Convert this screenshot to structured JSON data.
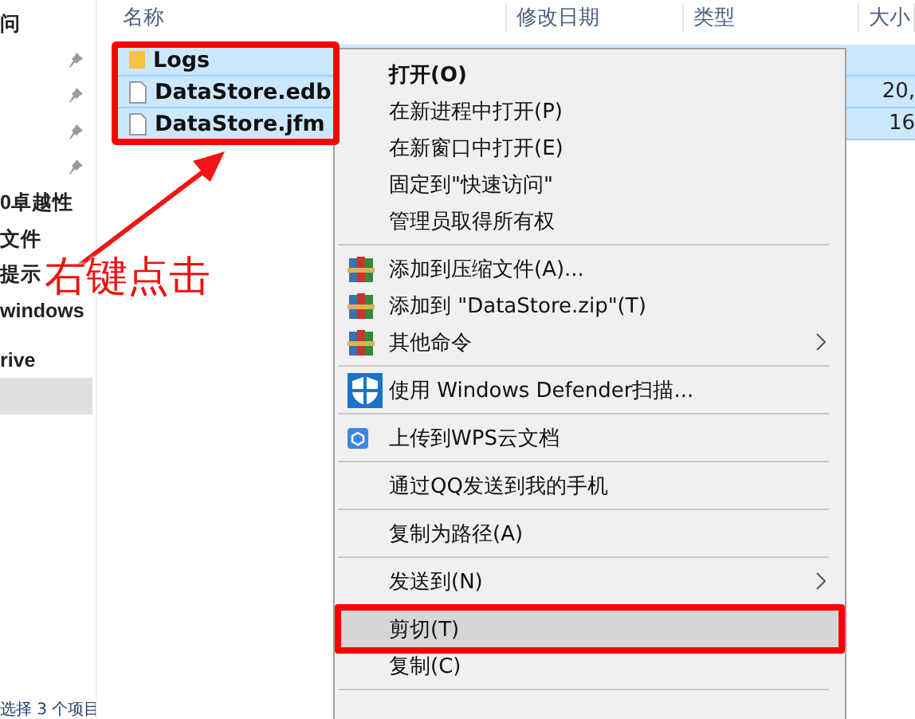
{
  "nav": {
    "items": [
      {
        "label": "问",
        "selected": false
      },
      {
        "pinned": true,
        "selected": false
      },
      {
        "pinned": true,
        "selected": false
      },
      {
        "pinned": true,
        "selected": false
      },
      {
        "pinned": true,
        "selected": false
      },
      {
        "label": "0卓越性",
        "selected": false
      },
      {
        "label": "文件",
        "selected": false
      },
      {
        "label": "提示",
        "selected": false
      },
      {
        "label": "windows",
        "selected": false
      },
      {
        "label": "rive",
        "selected": false,
        "kind": "group"
      },
      {
        "selected": true
      }
    ]
  },
  "status": "选择 3 个项目",
  "columns": [
    "名称",
    "修改日期",
    "类型",
    "大小"
  ],
  "files": [
    {
      "name": "Logs",
      "kind": "folder",
      "selected": true
    },
    {
      "name": "DataStore.edb",
      "kind": "file",
      "selected": true,
      "size": "20,"
    },
    {
      "name": "DataStore.jfm",
      "kind": "file",
      "selected": true,
      "size": "16"
    }
  ],
  "menu": [
    {
      "kind": "item",
      "label": "打开(O)",
      "bold": true,
      "selected": false
    },
    {
      "kind": "item",
      "label": "在新进程中打开(P)",
      "selected": false
    },
    {
      "kind": "item",
      "label": "在新窗口中打开(E)",
      "selected": false
    },
    {
      "kind": "item",
      "label": "固定到\"快速访问\"",
      "selected": false
    },
    {
      "kind": "item",
      "label": "管理员取得所有权",
      "selected": false
    },
    {
      "kind": "separator"
    },
    {
      "kind": "archive",
      "label": "添加到压缩文件(A)...",
      "selected": false
    },
    {
      "kind": "archive",
      "label": "添加到 \"DataStore.zip\"(T)",
      "selected": false
    },
    {
      "kind": "archive",
      "label": "其他命令",
      "submenu": true,
      "selected": false
    },
    {
      "kind": "separator"
    },
    {
      "kind": "shield",
      "label": "使用 Windows Defender扫描...",
      "selected": false
    },
    {
      "kind": "separator"
    },
    {
      "kind": "cloud",
      "label": "上传到WPS云文档",
      "selected": false
    },
    {
      "kind": "separator"
    },
    {
      "kind": "item",
      "label": "通过QQ发送到我的手机",
      "selected": false
    },
    {
      "kind": "separator"
    },
    {
      "kind": "item",
      "label": "复制为路径(A)",
      "selected": false
    },
    {
      "kind": "separator"
    },
    {
      "kind": "item",
      "label": "发送到(N)",
      "submenu": true,
      "selected": false
    },
    {
      "kind": "separator"
    },
    {
      "kind": "item",
      "label": "剪切(T)",
      "selected": true
    },
    {
      "kind": "item",
      "label": "复制(C)",
      "selected": false
    },
    {
      "kind": "separator"
    }
  ],
  "annotation": {
    "label": "右键点击"
  }
}
